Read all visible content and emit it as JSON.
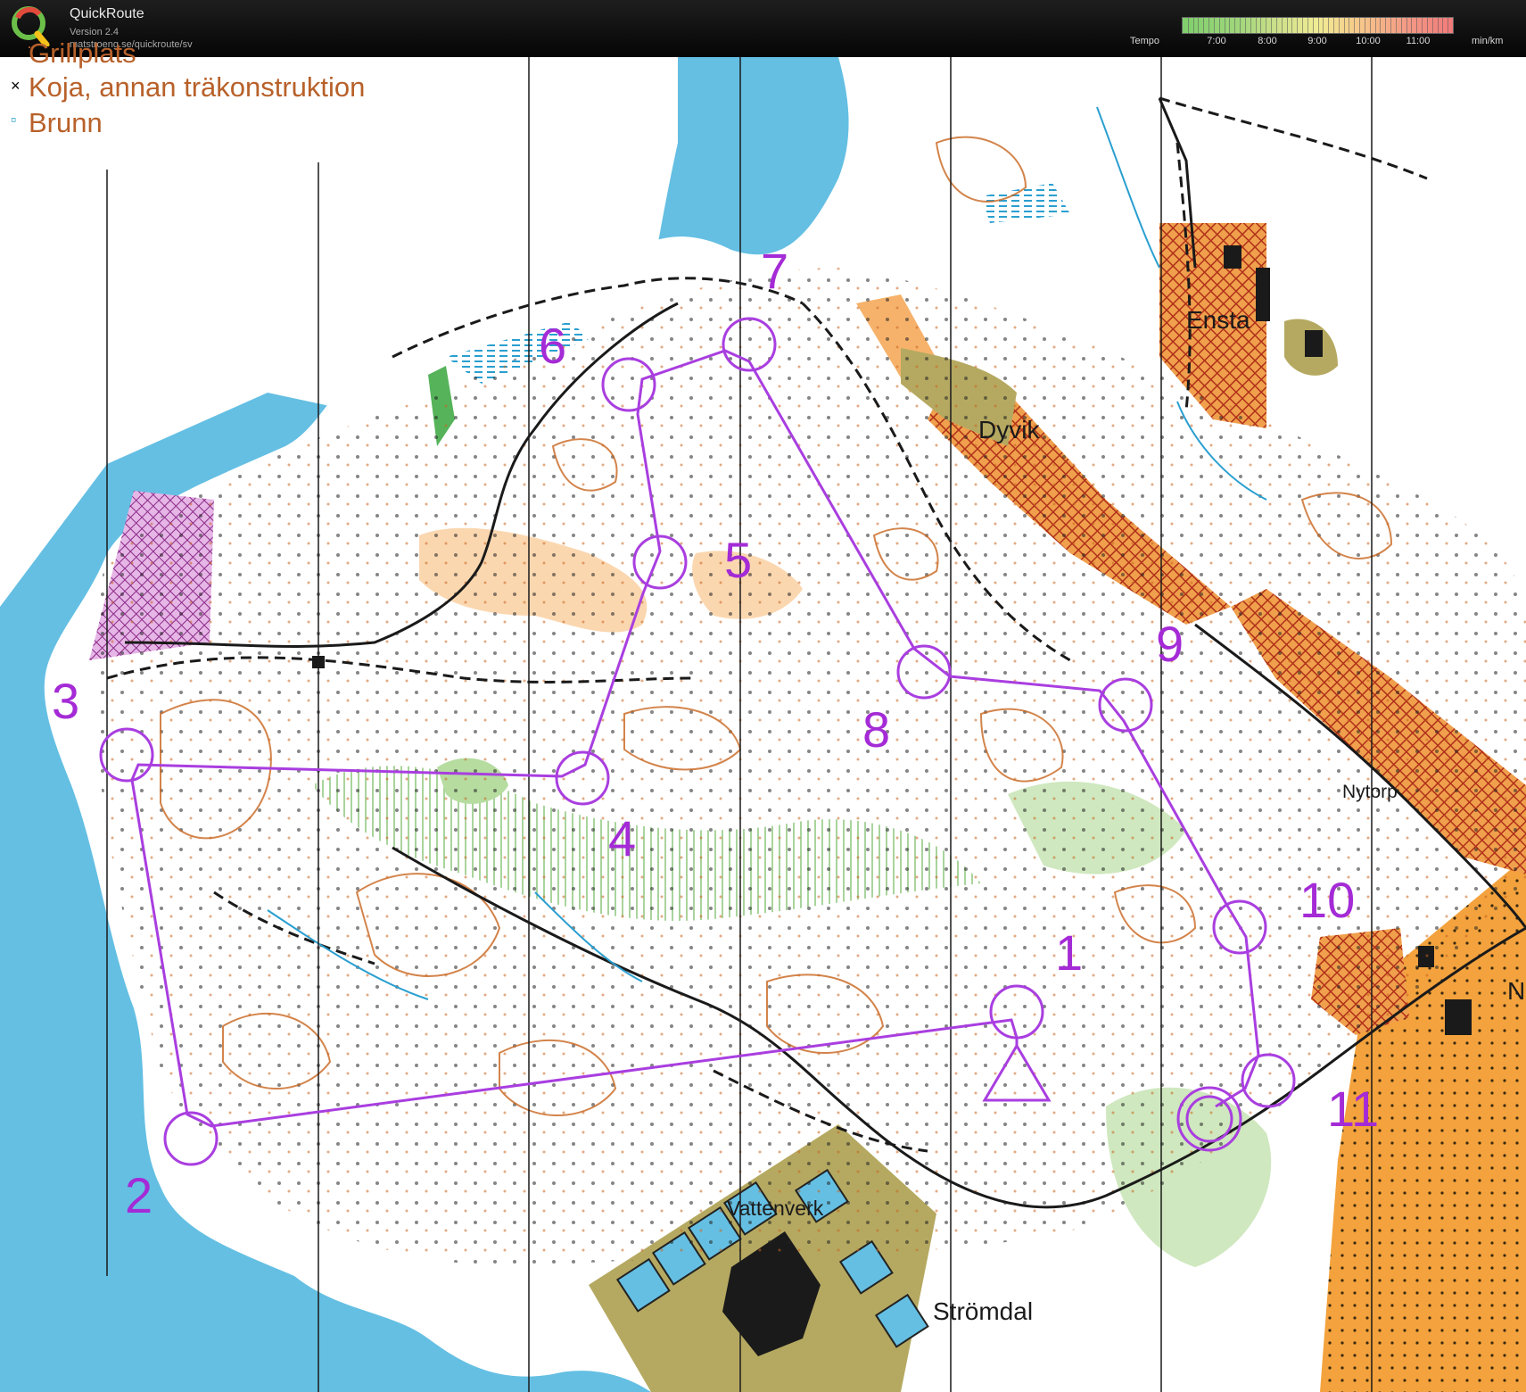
{
  "app": {
    "name": "QuickRoute",
    "version": "Version 2.4",
    "url": "matstroeng.se/quickroute/sv"
  },
  "tempo": {
    "label": "Tempo",
    "ticks": [
      "7:00",
      "8:00",
      "9:00",
      "10:00",
      "11:00"
    ],
    "unit": "min/km"
  },
  "legend": {
    "items": [
      {
        "symbol": "·",
        "text": "Grillplats",
        "symbol_color": "#b8612a"
      },
      {
        "symbol": "×",
        "text": "Koja, annan träkonstruktion",
        "symbol_color": "#000000"
      },
      {
        "symbol": "▫",
        "text": "Brunn",
        "symbol_color": "#1aa0c8"
      }
    ]
  },
  "places": {
    "ensta": "Ensta",
    "dyvik": "Dyvik",
    "nytorp": "Nytorp",
    "vattenverk": "Vattenverk",
    "stromdal": "Strömdal",
    "edge_n": "N"
  },
  "course": {
    "color": "#a93ee0",
    "controls": [
      {
        "number": "1"
      },
      {
        "number": "2"
      },
      {
        "number": "3"
      },
      {
        "number": "4"
      },
      {
        "number": "5"
      },
      {
        "number": "6"
      },
      {
        "number": "7"
      },
      {
        "number": "8"
      },
      {
        "number": "9"
      },
      {
        "number": "10"
      },
      {
        "number": "11"
      }
    ]
  },
  "colors": {
    "water": "#64bfe3",
    "forest": "#ffffff",
    "contour": "#c8651e",
    "open": "#f6b26b",
    "green": "#b6dca0",
    "marsh": "#2a9fd0",
    "urban": "#b5a961",
    "building": "#1a1a1a",
    "private": "#b83a1c",
    "course": "#a93ee0"
  }
}
